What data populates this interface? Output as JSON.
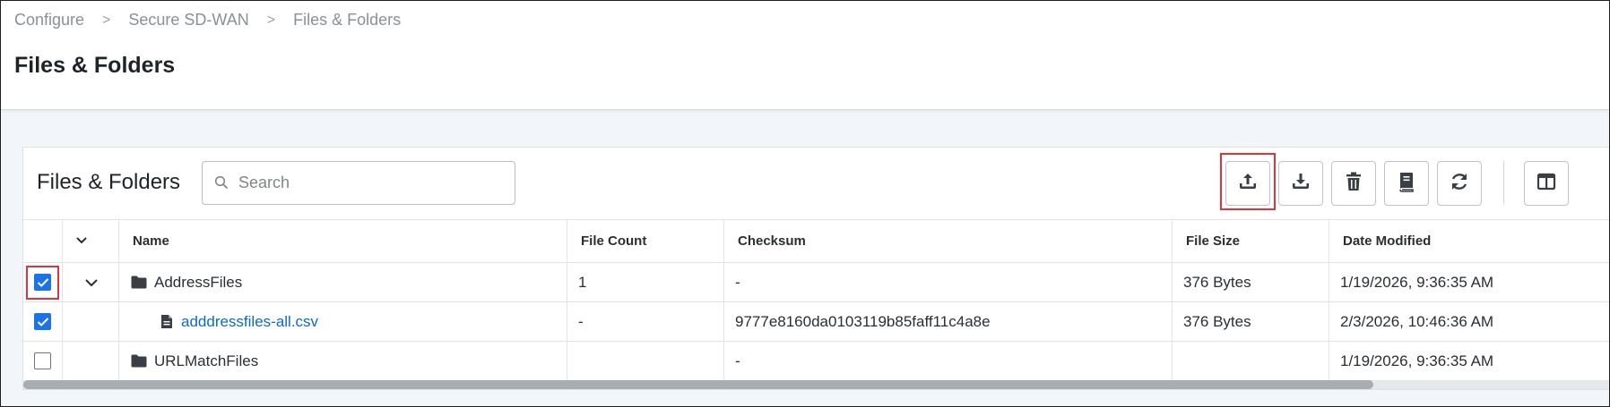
{
  "breadcrumb": {
    "items": [
      "Configure",
      "Secure SD-WAN",
      "Files & Folders"
    ],
    "separator": ">"
  },
  "page": {
    "title": "Files & Folders"
  },
  "panel": {
    "title": "Files & Folders",
    "search_placeholder": "Search",
    "search_value": ""
  },
  "toolbar": {
    "buttons": [
      {
        "name": "upload",
        "icon": "upload-icon",
        "highlighted": true
      },
      {
        "name": "download",
        "icon": "download-icon"
      },
      {
        "name": "delete",
        "icon": "trash-icon"
      },
      {
        "name": "details",
        "icon": "book-icon"
      },
      {
        "name": "refresh",
        "icon": "refresh-icon"
      },
      {
        "name": "columns",
        "icon": "columns-layout-icon"
      }
    ]
  },
  "table": {
    "columns": [
      "Name",
      "File Count",
      "Checksum",
      "File Size",
      "Date Modified"
    ],
    "rows": [
      {
        "checked": true,
        "highlighted": true,
        "expandable": true,
        "type": "folder",
        "indent": 0,
        "name": "AddressFiles",
        "file_count": "1",
        "checksum": "-",
        "file_size": "376 Bytes",
        "date_modified": "1/19/2026, 9:36:35 AM"
      },
      {
        "checked": true,
        "highlighted": false,
        "expandable": false,
        "type": "file",
        "indent": 1,
        "name": "adddressfiles-all.csv",
        "file_count": "-",
        "checksum": "9777e8160da0103119b85faff11c4a8e",
        "file_size": "376 Bytes",
        "date_modified": "2/3/2026, 10:46:36 AM"
      },
      {
        "checked": false,
        "highlighted": false,
        "expandable": false,
        "type": "folder",
        "indent": 0,
        "name": "URLMatchFiles",
        "file_count": "",
        "checksum": "-",
        "file_size": "",
        "date_modified": "1/19/2026, 9:36:35 AM"
      }
    ]
  },
  "scrollbar": {
    "position_fraction": 0.85
  },
  "colors": {
    "accent": "#1a73e8",
    "link": "#0b6ac9",
    "highlight_box": "#e0343a"
  }
}
